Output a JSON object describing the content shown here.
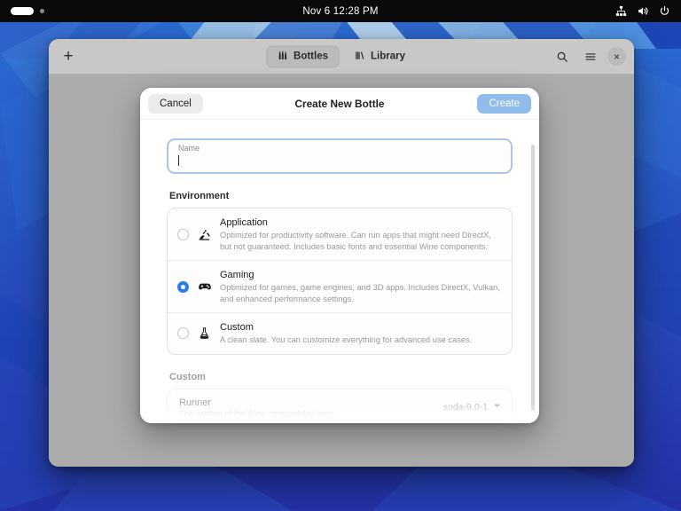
{
  "topbar": {
    "clock": "Nov 6  12:28 PM",
    "indicator_name": "activities-pill",
    "tray": [
      {
        "name": "network-icon"
      },
      {
        "name": "volume-icon"
      },
      {
        "name": "power-icon"
      }
    ]
  },
  "window": {
    "new_button_label": "+",
    "tabs": [
      {
        "label": "Bottles",
        "icon": "bottles-icon",
        "selected": true
      },
      {
        "label": "Library",
        "icon": "library-icon",
        "selected": false
      }
    ],
    "actions": [
      {
        "name": "search-icon"
      },
      {
        "name": "menu-icon"
      },
      {
        "label": "×",
        "name": "close-icon"
      }
    ]
  },
  "dialog": {
    "title": "Create New Bottle",
    "cancel_label": "Cancel",
    "create_label": "Create",
    "name_field": {
      "label": "Name",
      "value": "",
      "placeholder": "Name"
    },
    "environment": {
      "section_title": "Environment",
      "options": [
        {
          "title": "Application",
          "description": "Optimized for productivity software. Can run apps that might need DirectX, but not guaranteed. Includes basic fonts and essential Wine components.",
          "icon": "application-icon",
          "selected": false
        },
        {
          "title": "Gaming",
          "description": "Optimized for games, game engines, and 3D apps. Includes DirectX, Vulkan, and enhanced performance settings.",
          "icon": "gamepad-icon",
          "selected": true
        },
        {
          "title": "Custom",
          "description": "A clean slate. You can customize everything for advanced use cases.",
          "icon": "flask-icon",
          "selected": false
        }
      ]
    },
    "custom": {
      "section_title": "Custom",
      "runner": {
        "title": "Runner",
        "description": "The version of the Wine compatibility layer.",
        "value": "soda-9.0-1"
      }
    }
  },
  "colors": {
    "accent": "#2a7bf0",
    "create_button_bg": "#8fbcea",
    "headerbar_bg": "#c9c8c7",
    "desktop_blue": "#1e4fbd"
  }
}
